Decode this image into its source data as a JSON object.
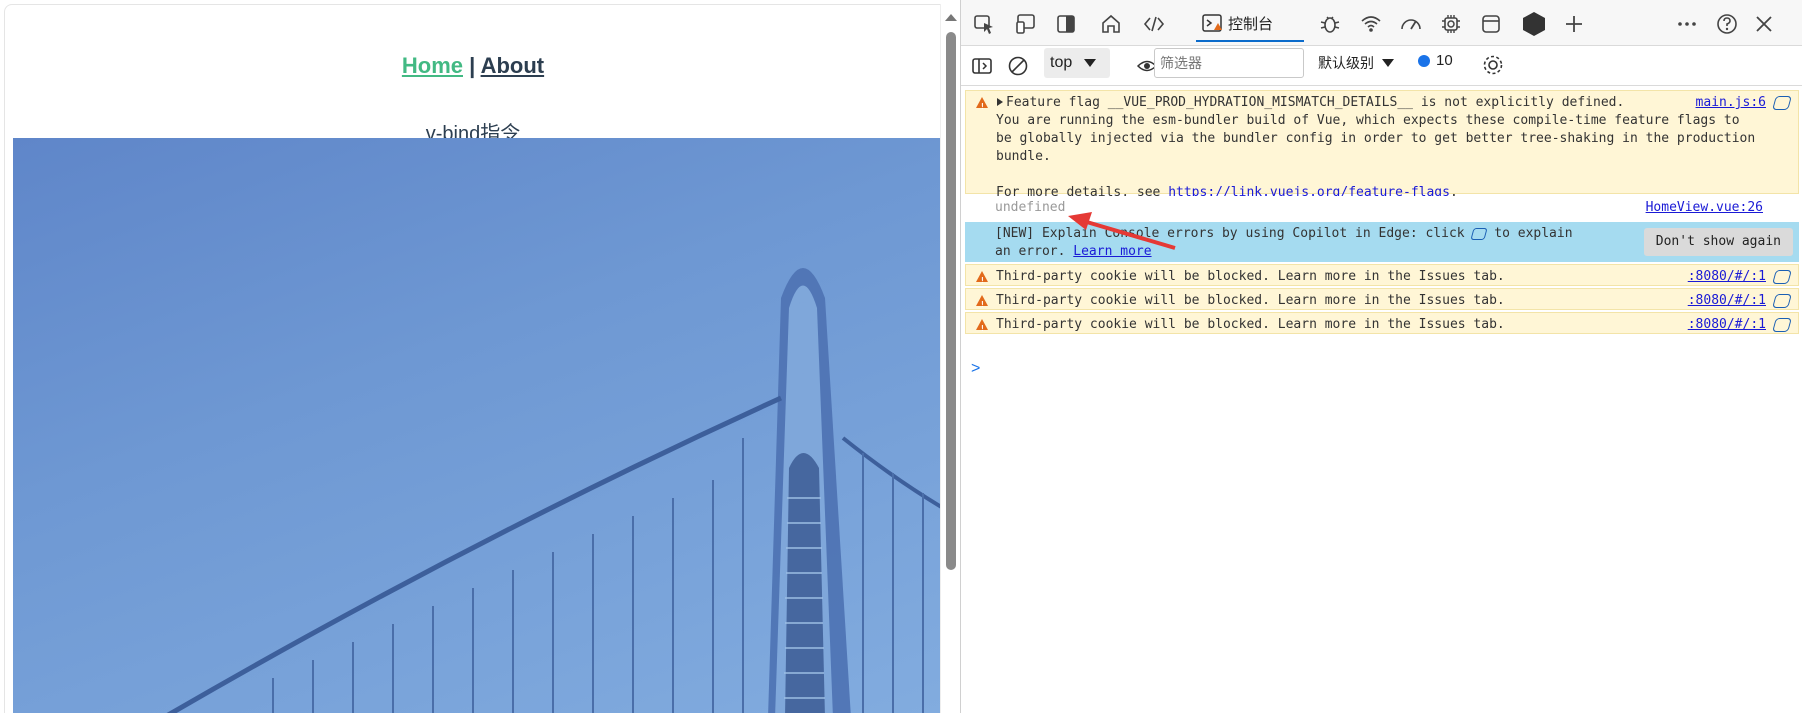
{
  "page": {
    "nav": {
      "home": "Home",
      "sep": "|",
      "about": "About"
    },
    "subtitle": "v-bind指令"
  },
  "devtools": {
    "tabs": {
      "console_label": "控制台"
    },
    "toolbar": {
      "context": "top",
      "filter_placeholder": "筛选器",
      "level": "默认级别",
      "count": "10"
    },
    "messages": [
      {
        "type": "warning",
        "text": "Feature flag __VUE_PROD_HYDRATION_MISMATCH_DETAILS__ is not explicitly defined.",
        "source": "main.js:6",
        "detail1": "You are running the esm-bundler build of Vue, which expects these compile-time feature flags to",
        "detail2": "be globally injected via the bundler config in order to get better tree-shaking in the production",
        "detail3": "bundle.",
        "more_prefix": "For more details, see ",
        "more_link": "https://link.vuejs.org/feature-flags",
        "more_suffix": "."
      },
      {
        "type": "log",
        "text": "undefined",
        "source": "HomeView.vue:26"
      },
      {
        "type": "info",
        "text1": "[NEW] Explain Console errors by using Copilot in Edge: click",
        "text1b": "to explain",
        "text2": "an error.",
        "link": "Learn more",
        "button": "Don't show again"
      },
      {
        "type": "warning",
        "text": "Third-party cookie will be blocked. Learn more in the Issues tab.",
        "source": ":8080/#/:1"
      },
      {
        "type": "warning",
        "text": "Third-party cookie will be blocked. Learn more in the Issues tab.",
        "source": ":8080/#/:1"
      },
      {
        "type": "warning",
        "text": "Third-party cookie will be blocked. Learn more in the Issues tab.",
        "source": ":8080/#/:1"
      }
    ],
    "prompt": ">"
  },
  "colors": {
    "accent": "#42b983",
    "link": "#1a1ad6",
    "arrow": "#e53935"
  }
}
